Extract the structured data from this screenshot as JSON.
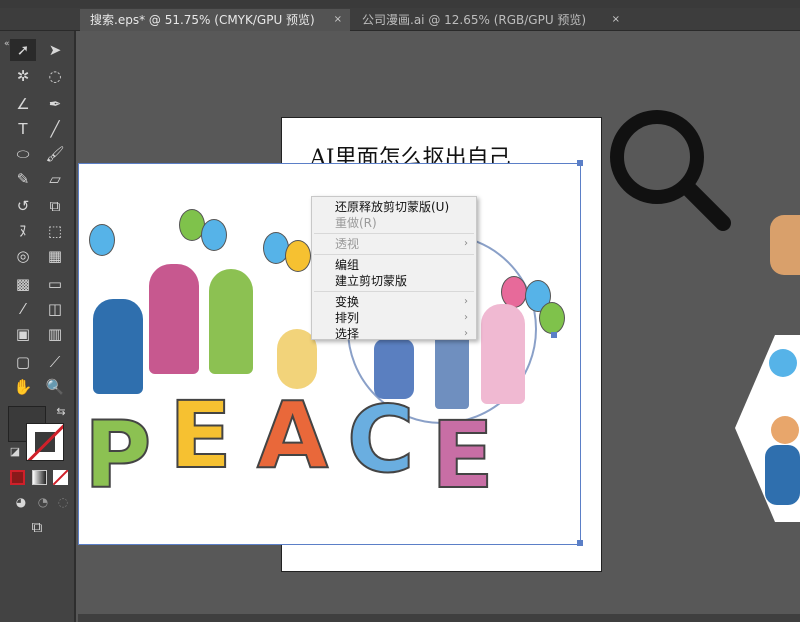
{
  "tabs": [
    {
      "label": "搜索.eps* @ 51.75% (CMYK/GPU 预览)",
      "active": true,
      "close": "×"
    },
    {
      "label": "公司漫画.ai @ 12.65% (RGB/GPU 预览)",
      "active": false,
      "close": "×"
    }
  ],
  "toolbar": {
    "collapse": "«"
  },
  "artboard": {
    "title": "AI里面怎么抠出自己"
  },
  "artwork": {
    "letters": [
      "P",
      "E",
      "A",
      "C",
      "E"
    ]
  },
  "context_menu": {
    "items": [
      {
        "label": "还原释放剪切蒙版(U)",
        "disabled": false
      },
      {
        "label": "重做(R)",
        "disabled": true
      },
      {
        "label": "透视",
        "disabled": true,
        "submenu": true
      },
      {
        "label": "编组",
        "disabled": false
      },
      {
        "label": "建立剪切蒙版",
        "disabled": false
      },
      {
        "label": "变换",
        "disabled": false,
        "submenu": true
      },
      {
        "label": "排列",
        "disabled": false,
        "submenu": true
      },
      {
        "label": "选择",
        "disabled": false,
        "submenu": true
      }
    ],
    "submenu_arrow": "›"
  },
  "colors": {
    "selection": "#5b7fc7",
    "fill_none_slash": "#d0202a"
  }
}
